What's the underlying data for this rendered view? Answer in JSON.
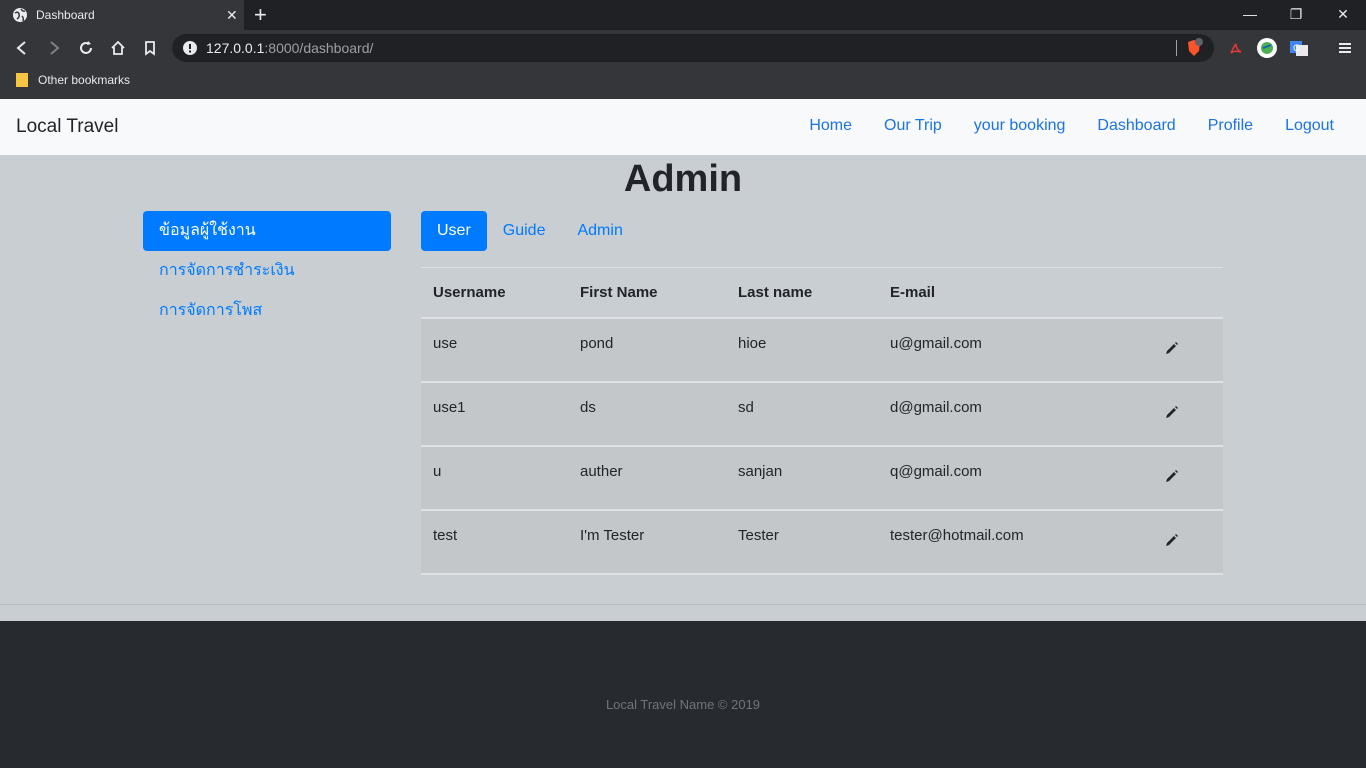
{
  "browser": {
    "tab_title": "Dashboard",
    "url_host": "127.0.0.1",
    "url_rest": ":8000/dashboard/",
    "bookmark_folder": "Other bookmarks",
    "brave_badge": "3"
  },
  "navbar": {
    "brand": "Local Travel",
    "links": [
      "Home",
      "Our Trip",
      "your booking",
      "Dashboard",
      "Profile",
      "Logout"
    ]
  },
  "page": {
    "title": "Admin"
  },
  "sidebar": {
    "items": [
      {
        "label": "ข้อมูลผู้ใช้งาน"
      },
      {
        "label": "การจัดการชำระเงิน"
      },
      {
        "label": "การจัดการโพส"
      }
    ]
  },
  "tabs": [
    "User",
    "Guide",
    "Admin"
  ],
  "table": {
    "headers": [
      "Username",
      "First Name",
      "Last name",
      "E-mail"
    ],
    "rows": [
      [
        "use",
        "pond",
        "hioe",
        "u@gmail.com"
      ],
      [
        "use1",
        "ds",
        "sd",
        "d@gmail.com"
      ],
      [
        "u",
        "auther",
        "sanjan",
        "q@gmail.com"
      ],
      [
        "test",
        "I'm Tester",
        "Tester",
        "tester@hotmail.com"
      ]
    ]
  },
  "footer": {
    "text": "Local Travel Name © 2019"
  },
  "colors": {
    "primary": "#007bff",
    "navbar_bg": "#f8f9fa",
    "page_bg": "#c8ced1",
    "footer_bg": "#272b30"
  }
}
